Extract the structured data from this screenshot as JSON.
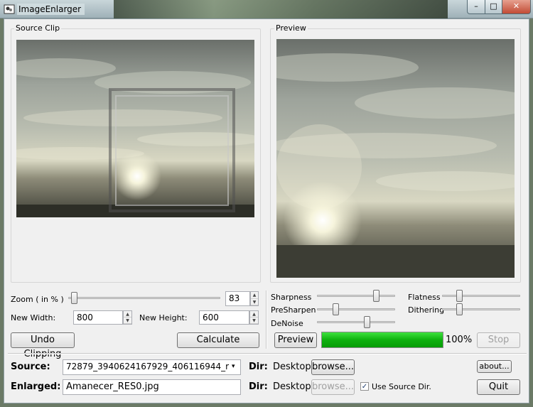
{
  "window": {
    "title": "ImageEnlarger",
    "close_glyph": "✕",
    "max_glyph": "□",
    "min_glyph": "–"
  },
  "source_clip": {
    "label": "Source Clip"
  },
  "preview_panel": {
    "label": "Preview"
  },
  "zoom": {
    "label": "Zoom ( in % )",
    "value": "83",
    "slider_fraction": 0.02
  },
  "new_width": {
    "label": "New Width:",
    "value": "800"
  },
  "new_height": {
    "label": "New Height:",
    "value": "600"
  },
  "buttons": {
    "undo_clipping": "Undo Clipping",
    "calculate": "Calculate",
    "preview": "Preview",
    "stop": "Stop",
    "browse_source": "browse...",
    "browse_enlarged": "browse...",
    "about": "about...",
    "quit": "Quit"
  },
  "sliders": {
    "sharpness": {
      "label": "Sharpness",
      "fraction": 0.78
    },
    "presharpen": {
      "label": "PreSharpen",
      "fraction": 0.22
    },
    "denoise": {
      "label": "DeNoise",
      "fraction": 0.65
    },
    "flatness": {
      "label": "Flatness",
      "fraction": 0.2
    },
    "dithering": {
      "label": "Dithering",
      "fraction": 0.2
    }
  },
  "progress": {
    "percent": 100,
    "text": "100%"
  },
  "source": {
    "label": "Source:",
    "value": "72879_3940624167929_406116944_r",
    "dir_label": "Dir:",
    "dir_value": "Desktop"
  },
  "enlarged": {
    "label": "Enlarged:",
    "value": "Amanecer_RES0.jpg",
    "dir_label": "Dir:",
    "dir_value": "Desktop"
  },
  "use_source_dir": {
    "label": "Use Source Dir.",
    "checked": true,
    "check_glyph": "✓"
  },
  "combo_arrow": "▾",
  "spin_up": "▲",
  "spin_down": "▼",
  "icons": [
    "app-icon",
    "minimize-icon",
    "maximize-icon",
    "close-icon",
    "dropdown-arrow-icon",
    "checkbox-check-icon"
  ]
}
